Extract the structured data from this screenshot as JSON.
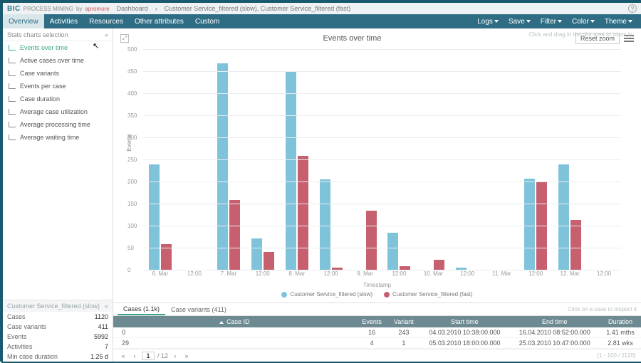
{
  "header": {
    "logo_main": "BIC",
    "logo_sub": "PROCESS MINING",
    "by": "by",
    "vendor": "apromore",
    "crumb_root": "Dashboard",
    "crumb_item": "Customer Service_filtered (slow), Customer Service_filtered (fast)"
  },
  "menubar": {
    "left": [
      "Overview",
      "Activities",
      "Resources",
      "Other attributes",
      "Custom"
    ],
    "right": [
      "Logs",
      "Save",
      "Filter",
      "Color",
      "Theme"
    ]
  },
  "sidebar": {
    "heading": "Stats charts selection",
    "items": [
      "Events over time",
      "Active cases over time",
      "Case variants",
      "Events per case",
      "Case duration",
      "Average case utilization",
      "Average processing time",
      "Average waiting time"
    ],
    "bottom_title": "Customer Service_filtered (slow)",
    "stats": [
      {
        "label": "Cases",
        "value": "1120"
      },
      {
        "label": "Case variants",
        "value": "411"
      },
      {
        "label": "Events",
        "value": "5992"
      },
      {
        "label": "Activities",
        "value": "7"
      },
      {
        "label": "Min case duration",
        "value": "1.25 d"
      }
    ]
  },
  "chart": {
    "hint": "Click and drag in the plot area to zoom in",
    "title": "Events over time",
    "reset": "Reset zoom",
    "legend": [
      "Customer Service_filtered (slow)",
      "Customer Service_filtered (fast)"
    ],
    "xlabel": "Timestamp"
  },
  "chart_data": {
    "type": "bar",
    "ylabel": "Events",
    "ylim": [
      0,
      500
    ],
    "yticks": [
      0,
      50,
      100,
      150,
      200,
      250,
      300,
      350,
      400,
      450,
      500
    ],
    "categories": [
      "6. Mar",
      "12:00",
      "7. Mar",
      "12:00",
      "8. Mar",
      "12:00",
      "9. Mar",
      "12:00",
      "10. Mar",
      "12:00",
      "11. Mar",
      "12:00",
      "12. Mar",
      "12:00"
    ],
    "series": [
      {
        "name": "Customer Service_filtered (slow)",
        "color": "#7fc3da",
        "values": [
          240,
          0,
          470,
          73,
          450,
          207,
          0,
          85,
          0,
          6,
          0,
          208,
          240,
          0
        ]
      },
      {
        "name": "Customer Service_filtered (fast)",
        "color": "#c6606f",
        "values": [
          60,
          0,
          160,
          42,
          260,
          7,
          135,
          10,
          25,
          0,
          0,
          200,
          115,
          0
        ]
      }
    ]
  },
  "table": {
    "click_hint": "Click on a case to inspect it",
    "tabs": [
      "Cases (1.1k)",
      "Case variants (411)"
    ],
    "headers": [
      "Case ID",
      "Events",
      "Variant",
      "Start time",
      "End time",
      "Duration"
    ],
    "rows": [
      {
        "id": "0",
        "events": "16",
        "variant": "243",
        "start": "04.03.2010 10:38:00.000",
        "end": "16.04.2010 08:52:00.000",
        "dur": "1.41 mths"
      },
      {
        "id": "29",
        "events": "4",
        "variant": "1",
        "start": "05.03.2010 18:00:00.000",
        "end": "25.03.2010 10:47:00.000",
        "dur": "2.81 wks"
      }
    ],
    "pager": {
      "page": "1",
      "total": "/ 12",
      "info": "[1 - 100 / 1120]"
    }
  }
}
